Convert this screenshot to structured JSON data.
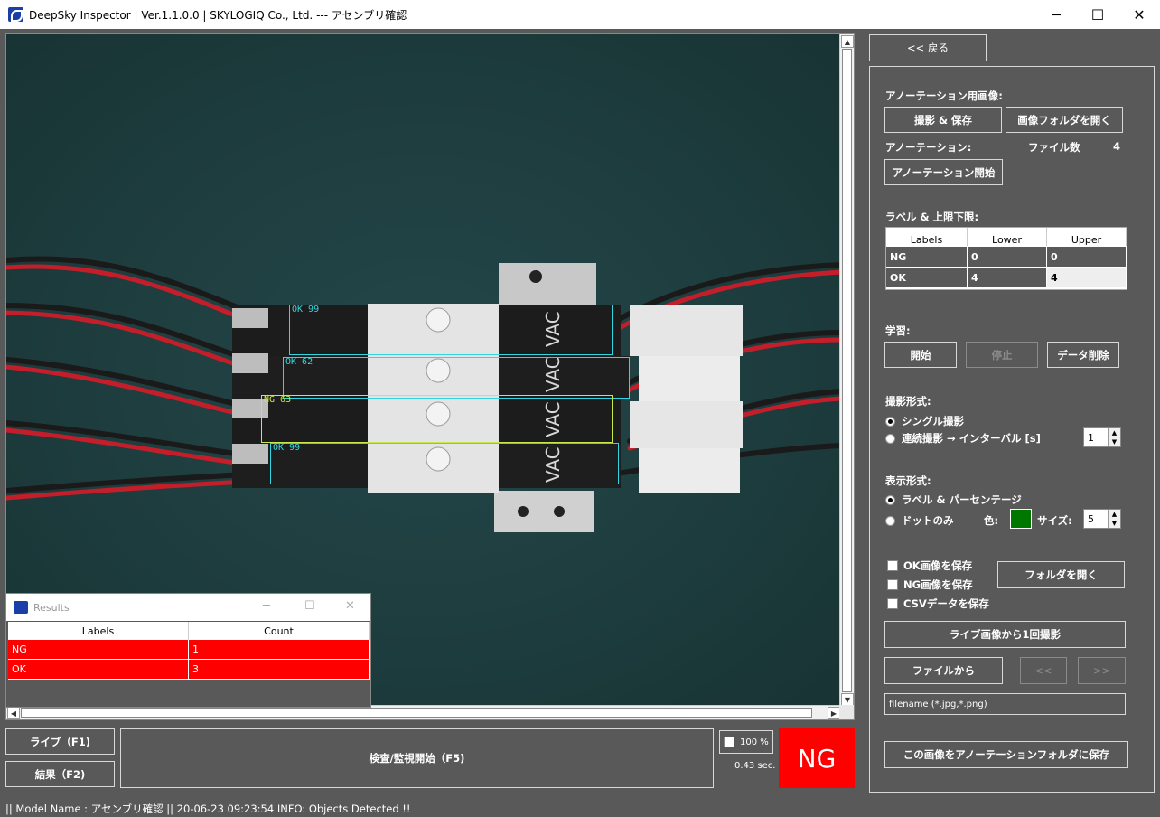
{
  "window": {
    "title": "DeepSky Inspector | Ver.1.1.0.0 | SKYLOGIQ Co., Ltd. --- アセンブリ確認"
  },
  "detections": [
    {
      "label": "OK 99",
      "color": "#33d6e0"
    },
    {
      "label": "OK 62",
      "color": "#33d6e0"
    },
    {
      "label": "NG 63",
      "color": "#c8e84a"
    },
    {
      "label": "OK 99",
      "color": "#33d6e0"
    }
  ],
  "results": {
    "title": "Results",
    "headers": [
      "Labels",
      "Count"
    ],
    "rows": [
      [
        "NG",
        "1"
      ],
      [
        "OK",
        "3"
      ]
    ]
  },
  "controls": {
    "live": "ライブ（F1)",
    "result": "結果（F2)",
    "inspect": "検査/監視開始（F5)",
    "percent": "100 %",
    "timing": "0.43 sec.",
    "judgement": "NG"
  },
  "status": "|| Model Name : アセンブリ確認 ||    20-06-23 09:23:54   INFO:   Objects Detected !!",
  "panel": {
    "back": "<< 戻る",
    "annot_images": "アノーテーション用画像:",
    "capture_save": "撮影 & 保存",
    "open_image_folder": "画像フォルダを開く",
    "annotation": "アノーテーション:",
    "file_count_label": "ファイル数",
    "file_count": "4",
    "start_annotation": "アノーテーション開始",
    "label_limits": "ラベル & 上限下限:",
    "limit_headers": [
      "Labels",
      "Lower",
      "Upper"
    ],
    "limit_rows": [
      [
        "NG",
        "0",
        "0"
      ],
      [
        "OK",
        "4",
        "4"
      ]
    ],
    "learning": "学習:",
    "learn_start": "開始",
    "learn_stop": "停止",
    "delete_data": "データ削除",
    "capture_mode": "撮影形式:",
    "single": "シングル撮影",
    "continuous": "連続撮影 → インターバル [s]",
    "interval": "1",
    "display_mode": "表示形式:",
    "label_pct": "ラベル & パーセンテージ",
    "dot_only": "ドットのみ",
    "color_label": "色:",
    "dot_color": "#007800",
    "size_label": "サイズ:",
    "size": "5",
    "save_ok": "OK画像を保存",
    "save_ng": "NG画像を保存",
    "save_csv": "CSVデータを保存",
    "open_folder": "フォルダを開く",
    "capture_once": "ライブ画像から1回撮影",
    "from_file": "ファイルから",
    "prev": "<<",
    "next": ">>",
    "filename_placeholder": "filename (*.jpg,*.png)",
    "save_to_annotation": "この画像をアノーテーションフォルダに保存"
  }
}
